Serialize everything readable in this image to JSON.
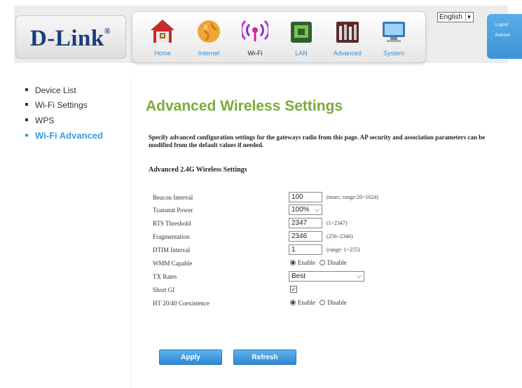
{
  "header": {
    "logo": "D-Link",
    "nav": [
      {
        "label": "Home",
        "icon": "home-icon"
      },
      {
        "label": "Internet",
        "icon": "globe-icon"
      },
      {
        "label": "Wi-Fi",
        "icon": "wifi-icon"
      },
      {
        "label": "LAN",
        "icon": "lan-icon"
      },
      {
        "label": "Advanced",
        "icon": "tools-icon"
      },
      {
        "label": "System",
        "icon": "monitor-icon"
      }
    ],
    "active_nav": "Wi-Fi",
    "language": "English",
    "logout": "Logout",
    "refresh": "Refresh"
  },
  "menu": {
    "items": [
      "Device List",
      "Wi-Fi Settings",
      "WPS",
      "Wi-Fi Advanced"
    ],
    "active": "Wi-Fi Advanced"
  },
  "main": {
    "title": "Advanced Wireless Settings",
    "description": "Specify advanced configuration settings for the gateways radio from this page. AP security and association parameters can be modified from the default values if needed.",
    "section_title": "Advanced 2.4G Wireless Settings",
    "fields": {
      "beacon": {
        "label": "Beacon Interval",
        "value": "100",
        "hint": "(msec, range:20~1024)"
      },
      "tx_power": {
        "label": "Transmit Power",
        "value": "100%"
      },
      "rts": {
        "label": "RTS Threshold",
        "value": "2347",
        "hint": "(1~2347)"
      },
      "frag": {
        "label": "Fragmentation",
        "value": "2346",
        "hint": "(256~2346)"
      },
      "dtim": {
        "label": "DTIM Interval",
        "value": "1",
        "hint": "(range: 1~255)"
      },
      "wmm": {
        "label": "WMM Capable",
        "enable": "Enable",
        "disable": "Disable",
        "selected": "Enable"
      },
      "tx_rates": {
        "label": "TX Rates",
        "value": "Best"
      },
      "short_gi": {
        "label": "Short GI",
        "checked": true
      },
      "ht_coexist": {
        "label": "HT 20/40 Coexistence",
        "enable": "Enable",
        "disable": "Disable",
        "selected": "Enable"
      }
    },
    "buttons": {
      "apply": "Apply",
      "refresh": "Refresh"
    }
  },
  "colors": {
    "title_green": "#7aab3a",
    "accent_blue": "#3a9bdc",
    "logo_navy": "#1a3d7c"
  }
}
